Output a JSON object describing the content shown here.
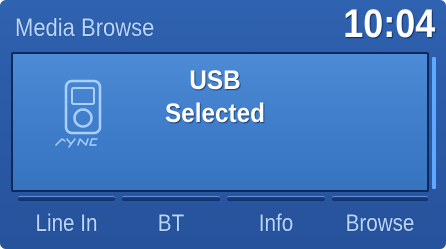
{
  "header": {
    "title": "Media Browse",
    "clock": "10:04"
  },
  "main": {
    "icon": "sync-media-player-icon",
    "icon_text": "SYNC",
    "status_line1": "USB",
    "status_line2": "Selected"
  },
  "softkeys": [
    {
      "label": "Line In"
    },
    {
      "label": "BT"
    },
    {
      "label": "Info"
    },
    {
      "label": "Browse"
    }
  ],
  "colors": {
    "background": "#2b5aa6",
    "panel": "#3f7cc9",
    "label": "#b9d7ff",
    "accent": "#5ea8ff",
    "text": "#ffffff"
  }
}
